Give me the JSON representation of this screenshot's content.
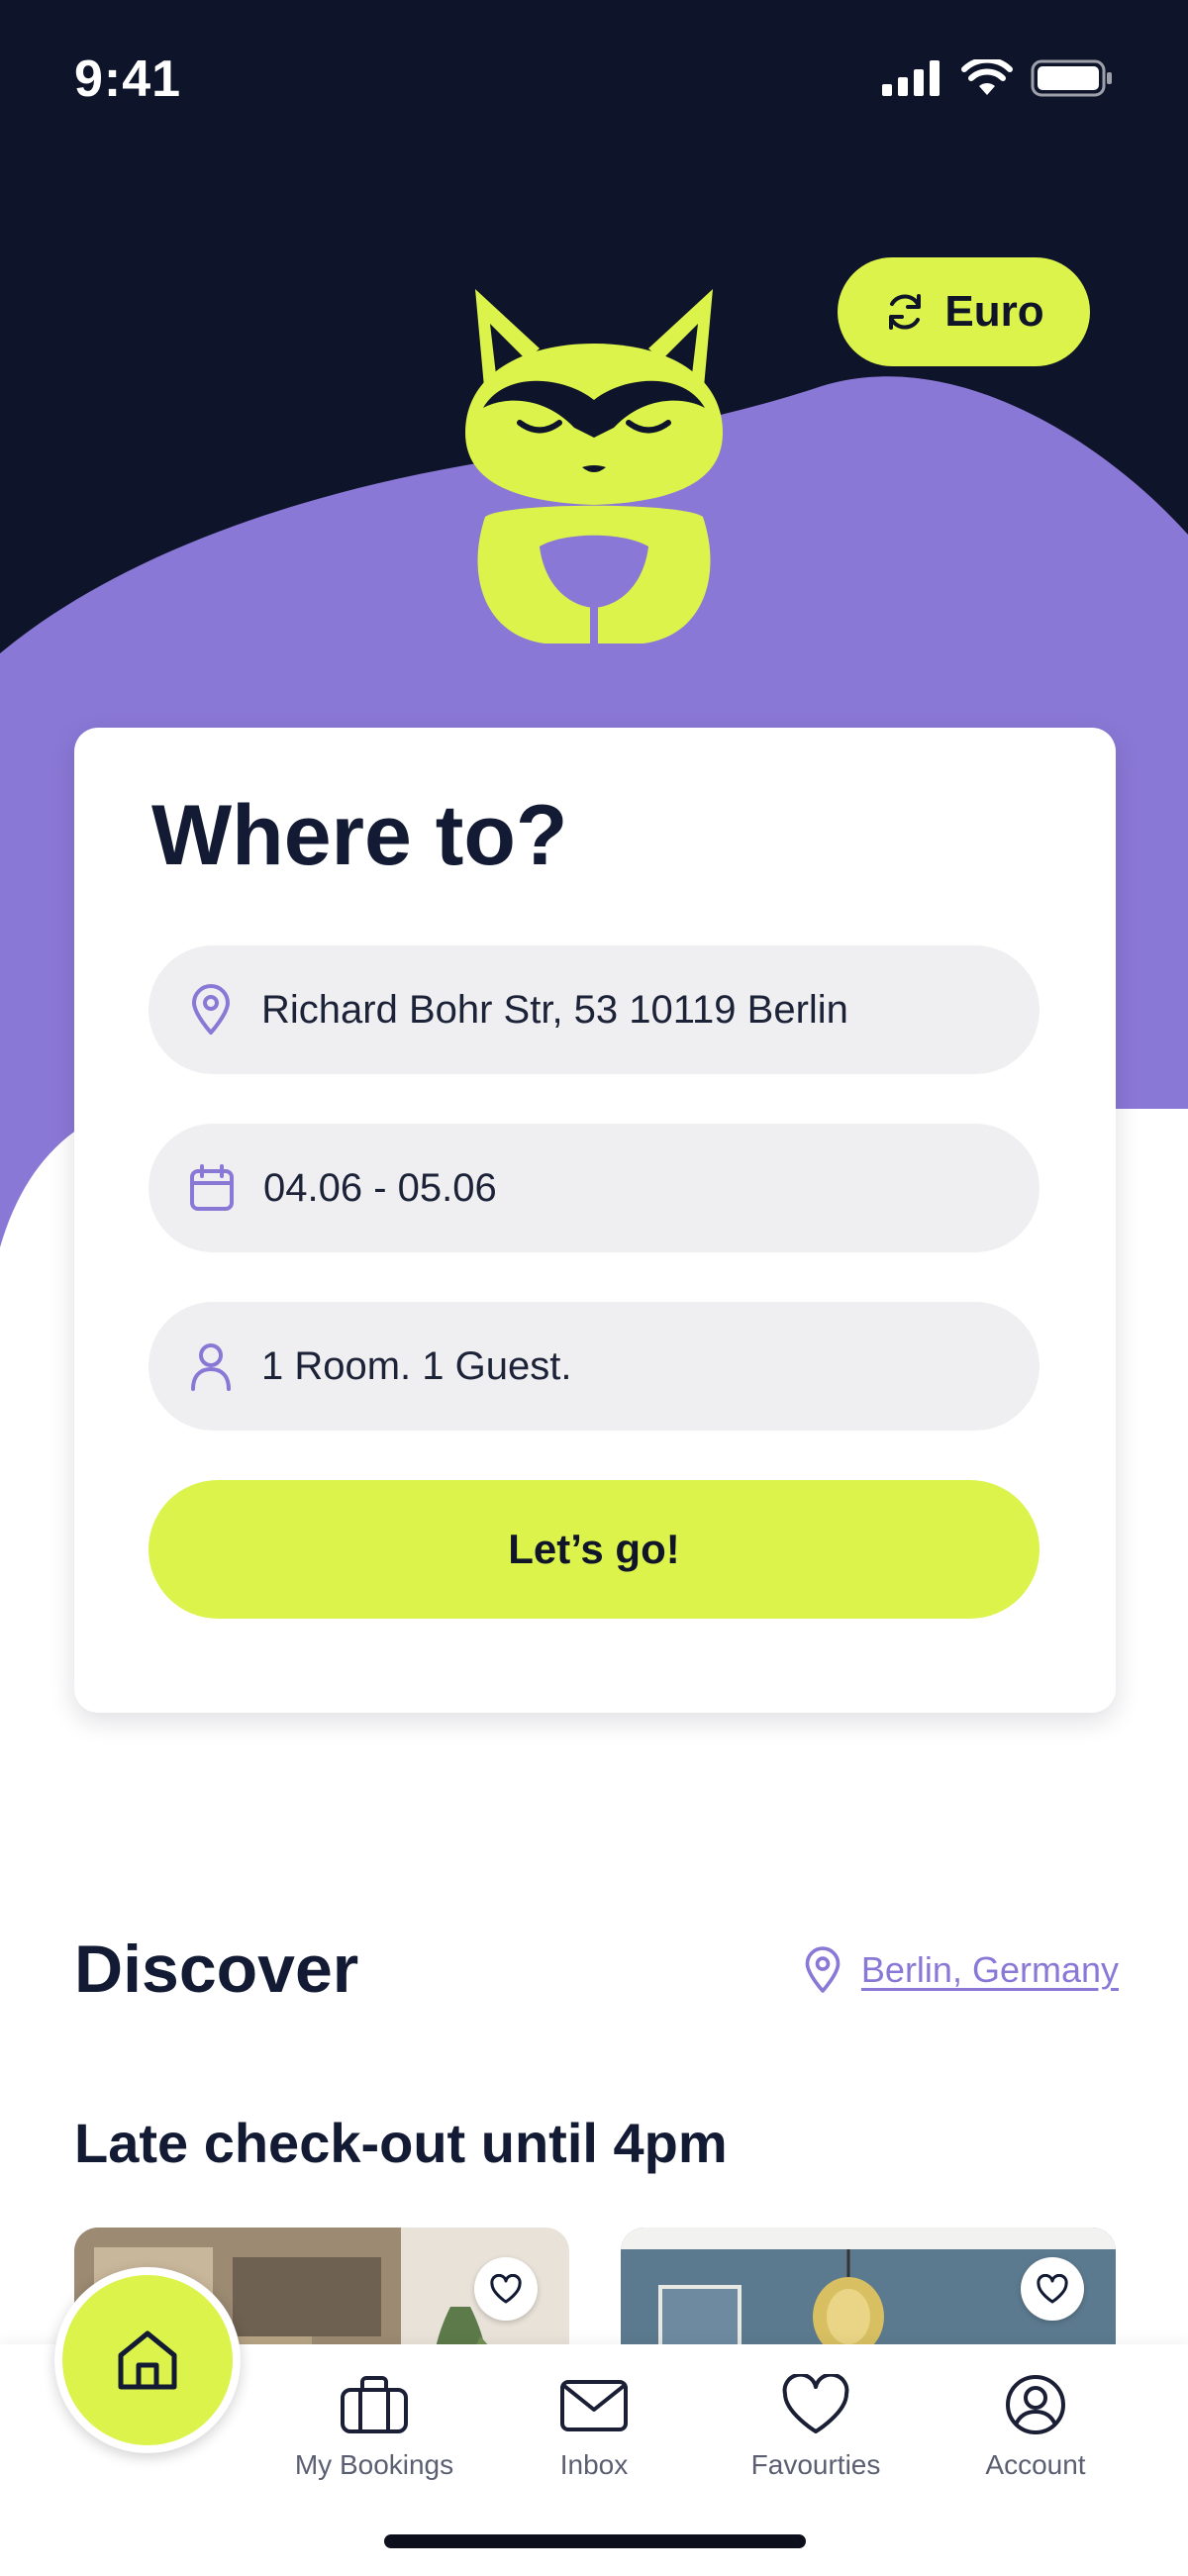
{
  "status_bar": {
    "time": "9:41",
    "icons": [
      "signal-icon",
      "wifi-icon",
      "battery-icon"
    ]
  },
  "colors": {
    "navy": "#0e1429",
    "purple": "#8a78d6",
    "lime": "#dbf34a",
    "field_bg": "#efeff1",
    "text_dark": "#131a33"
  },
  "header": {
    "currency_label": "Euro",
    "currency_icon": "refresh-icon",
    "mascot": "raccoon-mascot"
  },
  "search": {
    "title": "Where to?",
    "location_value": "Richard Bohr Str, 53 10119 Berlin",
    "dates_value": "04.06 - 05.06",
    "guests_value": "1 Room. 1 Guest.",
    "submit_label": "Let’s go!"
  },
  "discover": {
    "title": "Discover",
    "location_label": "Berlin, Germany",
    "section_title": "Late check-out until 4pm"
  },
  "tab_bar": {
    "items": [
      {
        "label": "",
        "icon": "home-icon"
      },
      {
        "label": "My Bookings",
        "icon": "briefcase-icon"
      },
      {
        "label": "Inbox",
        "icon": "envelope-icon"
      },
      {
        "label": "Favourties",
        "icon": "heart-icon"
      },
      {
        "label": "Account",
        "icon": "user-circle-icon"
      }
    ]
  }
}
